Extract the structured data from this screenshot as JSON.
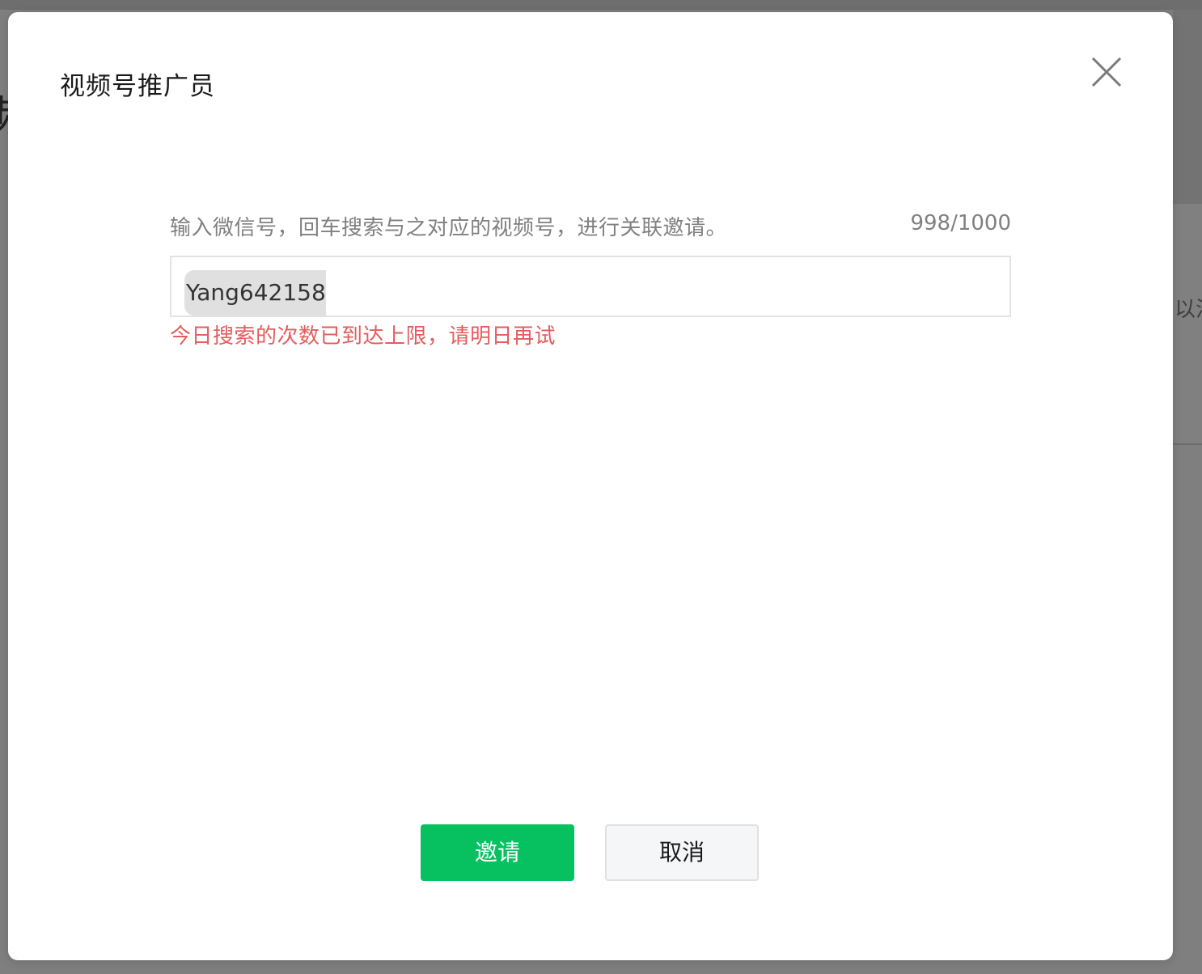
{
  "background": {
    "right_text": "以注",
    "left_text": "频"
  },
  "dialog": {
    "title": "视频号推广员",
    "close_icon": "close-icon",
    "hint": "输入微信号，回车搜索与之对应的视频号，进行关联邀请。",
    "counter": "998/1000",
    "input_value": "Yang642158",
    "error": "今日搜索的次数已到达上限，请明日再试",
    "invite_label": "邀请",
    "cancel_label": "取消"
  },
  "colors": {
    "primary": "#07c160",
    "error": "#e35d5d",
    "overlay": "#7f7f7f"
  }
}
